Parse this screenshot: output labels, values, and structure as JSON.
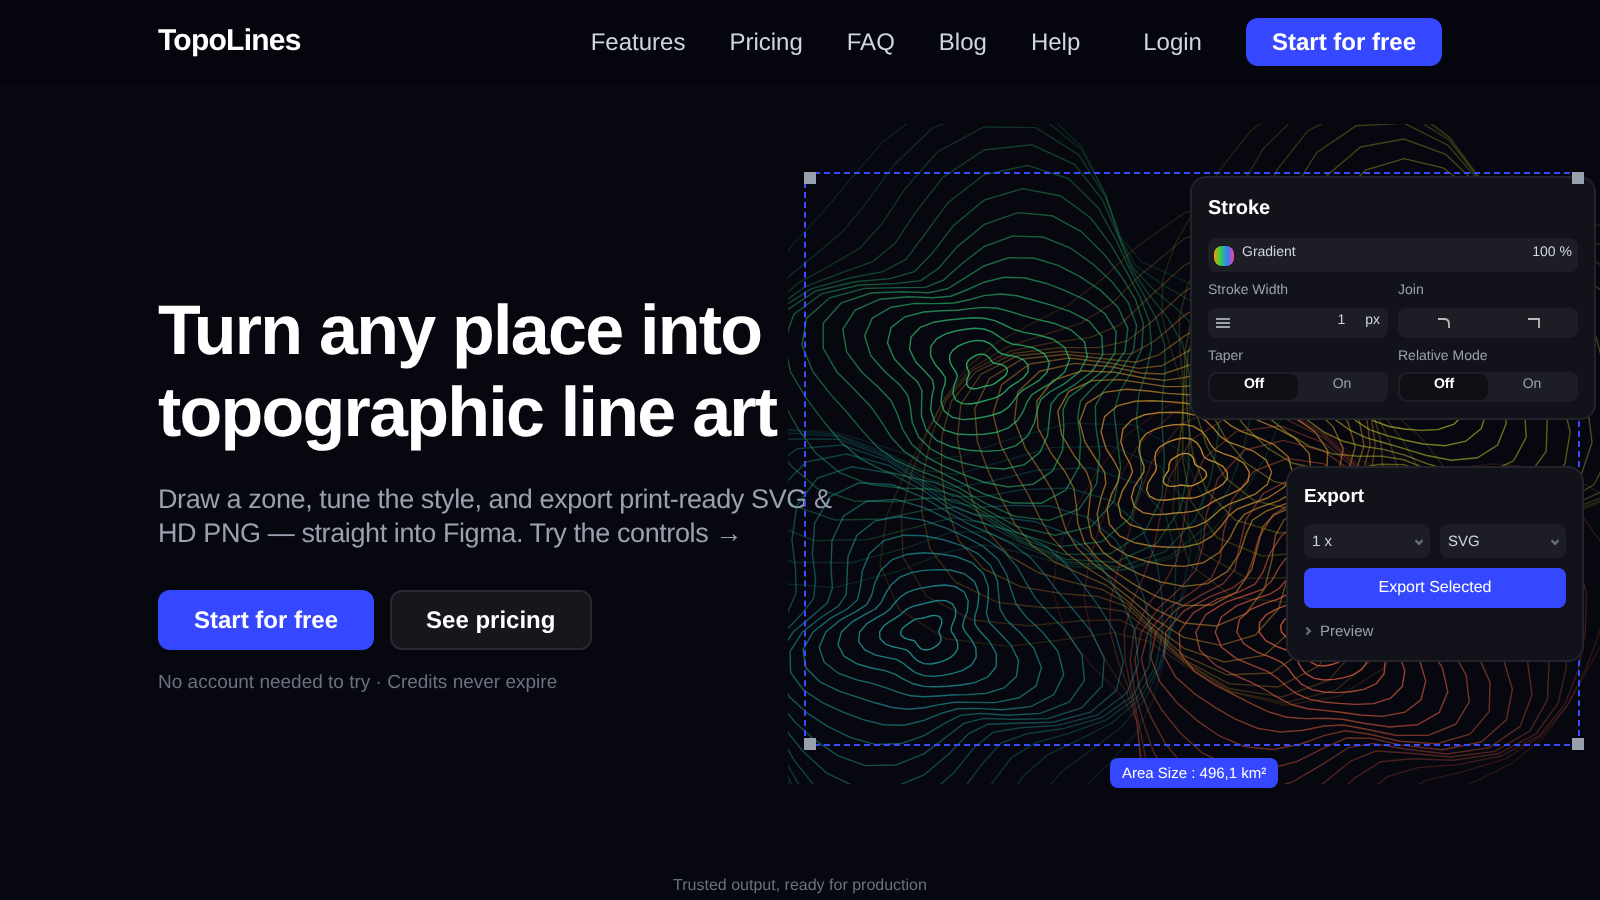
{
  "nav": {
    "logo": "TopoLines",
    "links": [
      "Features",
      "Pricing",
      "FAQ",
      "Blog",
      "Help"
    ],
    "login": "Login",
    "cta": "Start for free"
  },
  "hero": {
    "heading": "Turn any place into topographic line art",
    "subheading": "Draw a zone, tune the style, and export print-ready SVG & HD PNG — straight into Figma. Try the controls →",
    "buttons": [
      {
        "label": "Start for free",
        "kind": "primary"
      },
      {
        "label": "See pricing",
        "kind": "secondary"
      }
    ],
    "note": "No account needed to try · Credits never expire"
  },
  "stroke_panel": {
    "title": "Stroke",
    "gradient": {
      "label": "Gradient",
      "value": "100 %"
    },
    "stroke_width": {
      "label": "Stroke Width",
      "value": "1",
      "unit": "px"
    },
    "join": {
      "label": "Join"
    },
    "toggles": [
      {
        "label": "Taper",
        "options": [
          {
            "label": "Off",
            "selected": true
          },
          {
            "label": "On",
            "selected": false
          }
        ]
      },
      {
        "label": "Relative Mode",
        "options": [
          {
            "label": "Off",
            "selected": true
          },
          {
            "label": "On",
            "selected": false
          }
        ]
      }
    ]
  },
  "export_panel": {
    "title": "Export",
    "scale": "1 x",
    "format": "SVG",
    "button": "Export Selected",
    "preview": "Preview"
  },
  "area_badge": "Area Size : 496,1 km²",
  "footer_text": "Trusted output, ready for production"
}
